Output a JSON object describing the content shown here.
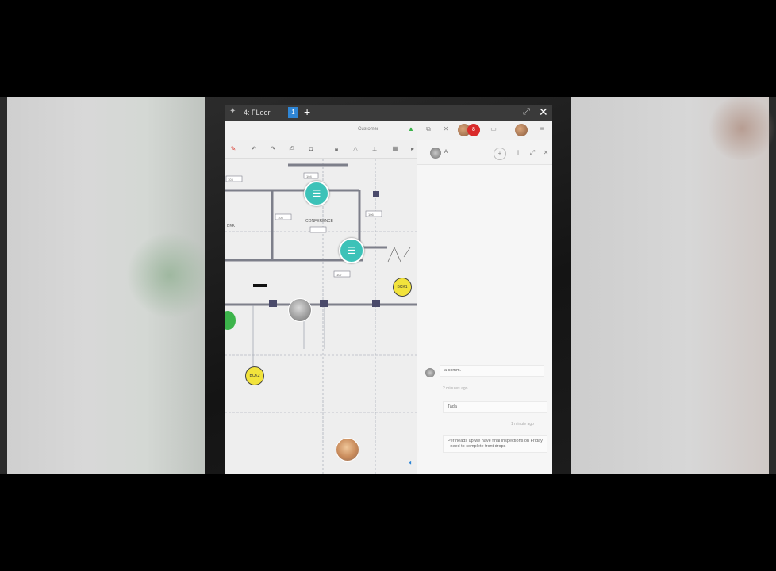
{
  "window": {
    "title": "4: FLoor",
    "tab_count": "1",
    "add_tab": "+",
    "expand": "⤢",
    "close": "✕"
  },
  "topbar": {
    "label": "Customer",
    "notification_count": "8"
  },
  "plan": {
    "room_label": "CONFERENCE",
    "room_tags": [
      "103",
      "104",
      "105",
      "106",
      "107"
    ],
    "marker_labels": [
      "BCK1",
      "BCK2"
    ],
    "left_label": "BKK"
  },
  "chat": {
    "header_name": "Al",
    "messages": [
      {
        "text": "a comm.",
        "meta": "2 minutes ago"
      },
      {
        "text": "Tada",
        "meta": "1 minute ago"
      },
      {
        "text": "Per heads up we have final inspections on Friday - need to complete front drops"
      }
    ]
  }
}
